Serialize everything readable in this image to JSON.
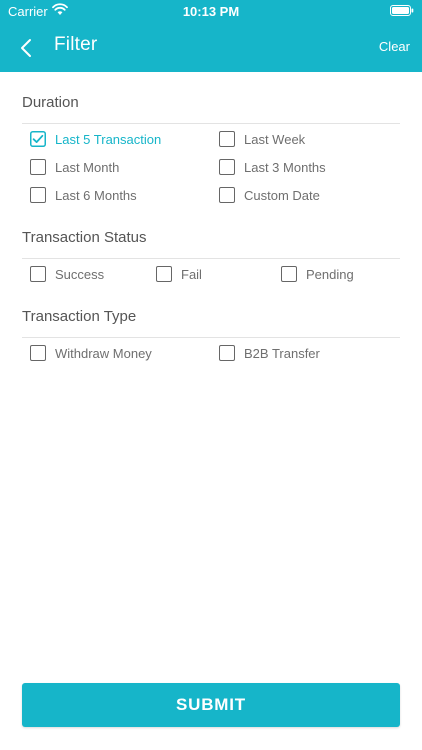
{
  "status_bar": {
    "carrier": "Carrier",
    "time": "10:13 PM"
  },
  "navbar": {
    "title": "Filter",
    "clear_label": "Clear"
  },
  "colors": {
    "accent": "#16b5c9",
    "text": "#6f6f6f",
    "heading": "#555555",
    "divider": "#e3e3e3"
  },
  "icons": {
    "back": "chevron-left-icon",
    "check": "checkmark-icon",
    "wifi": "wifi-icon",
    "battery": "battery-icon"
  },
  "sections": {
    "duration": {
      "title": "Duration",
      "options": [
        {
          "label": "Last 5 Transaction",
          "checked": true
        },
        {
          "label": "Last Week",
          "checked": false
        },
        {
          "label": "Last Month",
          "checked": false
        },
        {
          "label": "Last 3 Months",
          "checked": false
        },
        {
          "label": "Last 6 Months",
          "checked": false
        },
        {
          "label": "Custom Date",
          "checked": false
        }
      ]
    },
    "status": {
      "title": "Transaction Status",
      "options": [
        {
          "label": "Success",
          "checked": false
        },
        {
          "label": "Fail",
          "checked": false
        },
        {
          "label": "Pending",
          "checked": false
        }
      ]
    },
    "type": {
      "title": "Transaction Type",
      "options": [
        {
          "label": "Withdraw Money",
          "checked": false
        },
        {
          "label": "B2B Transfer",
          "checked": false
        }
      ]
    }
  },
  "submit_label": "SUBMIT"
}
